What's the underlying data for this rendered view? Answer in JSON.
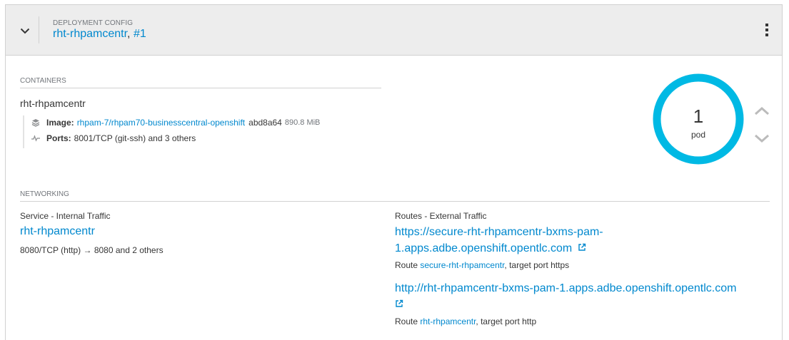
{
  "header": {
    "label": "DEPLOYMENT CONFIG",
    "name": "rht-rhpamcentr",
    "separator": ",",
    "revision": "#1"
  },
  "containers": {
    "section_label": "CONTAINERS",
    "name": "rht-rhpamcentr",
    "image_label": "Image:",
    "image_link": "rhpam-7/rhpam70-businesscentral-openshift",
    "image_hash": "abd8a64",
    "image_size": "890.8 MiB",
    "ports_label": "Ports:",
    "ports_value": "8001/TCP (git-ssh) and 3 others"
  },
  "pods": {
    "count": "1",
    "unit": "pod",
    "ring_color": "#00b9e4"
  },
  "networking": {
    "section_label": "NETWORKING",
    "service": {
      "heading": "Service - Internal Traffic",
      "name": "rht-rhpamcentr",
      "ports": "8080/TCP (http) → 8080 and 2 others"
    },
    "routes": {
      "heading": "Routes - External Traffic",
      "items": [
        {
          "url_line1": "https://secure-rht-rhpamcentr-bxms-pam-",
          "url_line2": "1.apps.adbe.openshift.opentlc.com",
          "route_prefix": "Route",
          "route_name": "secure-rht-rhpamcentr",
          "route_suffix": ", target port https"
        },
        {
          "url_line1": "http://rht-rhpamcentr-bxms-pam-1.apps.adbe.openshift.opentlc.com",
          "url_line2": "",
          "route_prefix": "Route",
          "route_name": "rht-rhpamcentr",
          "route_suffix": ", target port http"
        }
      ]
    }
  },
  "colors": {
    "link": "#0088ce",
    "header_bg": "#ededed",
    "accent": "#00b9e4"
  }
}
